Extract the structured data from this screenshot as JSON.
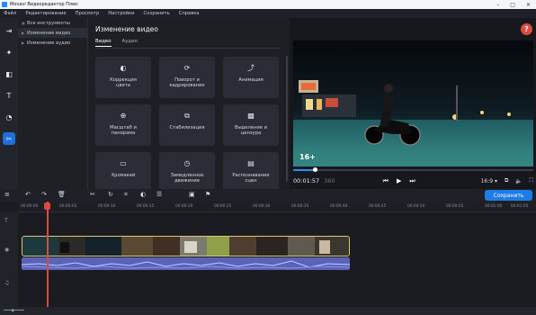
{
  "window": {
    "title": "Movavi Видеоредактор Плюс"
  },
  "menu": [
    "Файл",
    "Редактирование",
    "Просмотр",
    "Настройки",
    "Сохранить",
    "Справка"
  ],
  "tree": [
    {
      "label": "Все инструменты",
      "selected": false
    },
    {
      "label": "Изменение видео",
      "selected": true
    },
    {
      "label": "Изменение аудио",
      "selected": false
    }
  ],
  "panel": {
    "title": "Изменение видео",
    "tabs": [
      {
        "label": "Видео",
        "active": true
      },
      {
        "label": "Аудио",
        "active": false
      }
    ],
    "tools": [
      {
        "label": "Коррекция\nцвета",
        "icon": "color-correction-icon"
      },
      {
        "label": "Поворот и\nкадрирование",
        "icon": "crop-rotate-icon"
      },
      {
        "label": "Анимация",
        "icon": "animation-icon"
      },
      {
        "label": "Масштаб и\nпанорама",
        "icon": "zoom-pan-icon"
      },
      {
        "label": "Стабилизация",
        "icon": "stabilization-icon"
      },
      {
        "label": "Выделение и\nцензура",
        "icon": "highlight-censor-icon"
      },
      {
        "label": "Хромакей",
        "icon": "chroma-key-icon"
      },
      {
        "label": "Замедленное\nдвижение",
        "icon": "slow-motion-icon"
      },
      {
        "label": "Распознавание\nсцен",
        "icon": "scene-detection-icon"
      }
    ]
  },
  "preview": {
    "age_rating": "16+",
    "timecode": "00:01:57",
    "timecode_frames": "360",
    "aspect_ratio": "16:9 ▾",
    "progress_fraction": 0.09
  },
  "toolbar": {
    "save_label": "Сохранить"
  },
  "ruler": {
    "ticks": [
      "00:00:00",
      "00:00:05",
      "00:00:10",
      "00:00:15",
      "00:00:20",
      "00:00:25",
      "00:00:30",
      "00:00:35",
      "00:00:40",
      "00:00:45",
      "00:00:50",
      "00:00:55",
      "00:01:00",
      "00:01:05"
    ]
  },
  "colors": {
    "accent": "#1e7ce6",
    "playhead": "#e2463c",
    "clip_border": "#e2c46a",
    "audio_wave": "#5a63b8",
    "help": "#d94d3f"
  }
}
